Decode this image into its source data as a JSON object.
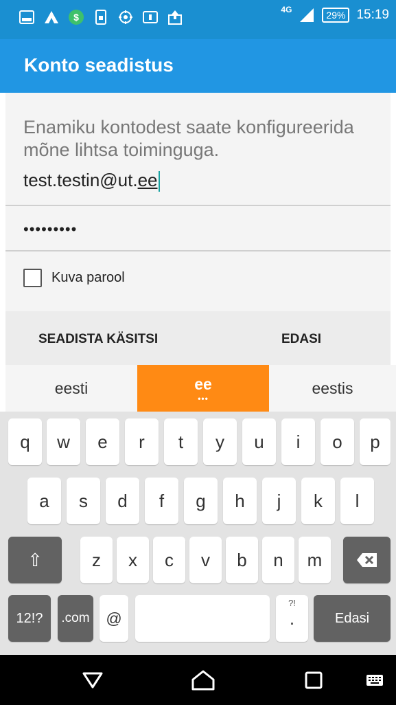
{
  "status_bar": {
    "network": "4G",
    "battery": "29%",
    "time": "15:19",
    "coin_glyph": "$",
    "icons": [
      "gallery-icon",
      "arrow-icon",
      "coin-icon",
      "sim-icon",
      "settings-icon",
      "chat-icon",
      "upload-icon"
    ]
  },
  "app_bar": {
    "title": "Konto seadistus"
  },
  "form": {
    "intro": "Enamiku kontodest saate konfigureerida mõne lihtsa toiminguga.",
    "email_prefix": "test.testin@ut.",
    "email_suffix": "ee",
    "password_mask": "•••••••••",
    "show_password_label": "Kuva parool"
  },
  "actions": {
    "manual_label": "SEADISTA KÄSITSI",
    "next_label": "EDASI"
  },
  "suggestions": {
    "left": "eesti",
    "middle": "ee",
    "middle_dots": "•••",
    "right": "eestis"
  },
  "keyboard": {
    "row1": [
      "q",
      "w",
      "e",
      "r",
      "t",
      "y",
      "u",
      "i",
      "o",
      "p"
    ],
    "row2": [
      "a",
      "s",
      "d",
      "f",
      "g",
      "h",
      "j",
      "k",
      "l"
    ],
    "row3": [
      "z",
      "x",
      "c",
      "v",
      "b",
      "n",
      "m"
    ],
    "shift_glyph": "⇧",
    "symbols_label": "12!?",
    "com_label": ".com",
    "at_label": "@",
    "period_label": ".",
    "period_sub": "?!",
    "enter_label": "Edasi"
  },
  "colors": {
    "status_bar": "#1a8fd1",
    "app_bar": "#2196e3",
    "suggestion_highlight": "#ff8a14",
    "cursor": "#1aa3a3"
  }
}
